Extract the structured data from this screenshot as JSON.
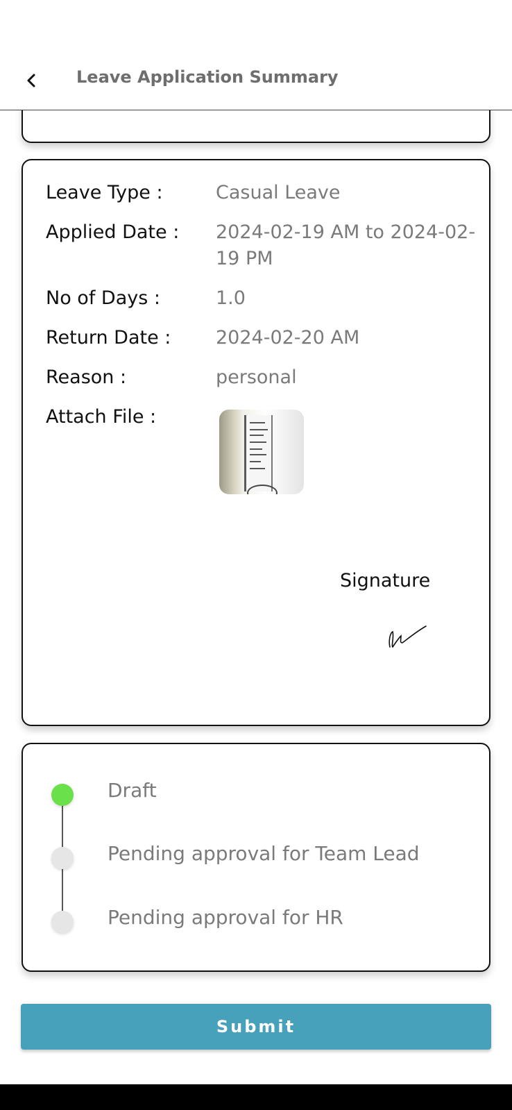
{
  "header": {
    "title": "Leave Application Summary"
  },
  "details": {
    "leave_type_label": "Leave Type :",
    "leave_type_value": "Casual Leave",
    "applied_date_label": "Applied Date :",
    "applied_date_value": "2024-02-19 AM to 2024-02-19 PM",
    "no_of_days_label": "No of Days :",
    "no_of_days_value": "1.0",
    "return_date_label": "Return Date :",
    "return_date_value": "2024-02-20 AM",
    "reason_label": "Reason :",
    "reason_value": "personal",
    "attach_file_label": "Attach File :",
    "signature_label": "Signature"
  },
  "status": {
    "steps": [
      {
        "label": "Draft",
        "state": "active"
      },
      {
        "label": "Pending approval for Team Lead",
        "state": "inactive"
      },
      {
        "label": "Pending approval for HR",
        "state": "inactive"
      }
    ],
    "active_color": "#6ae04a",
    "inactive_color": "#e6e6e6"
  },
  "actions": {
    "submit_label": "Submit",
    "submit_color": "#48a1bb"
  }
}
